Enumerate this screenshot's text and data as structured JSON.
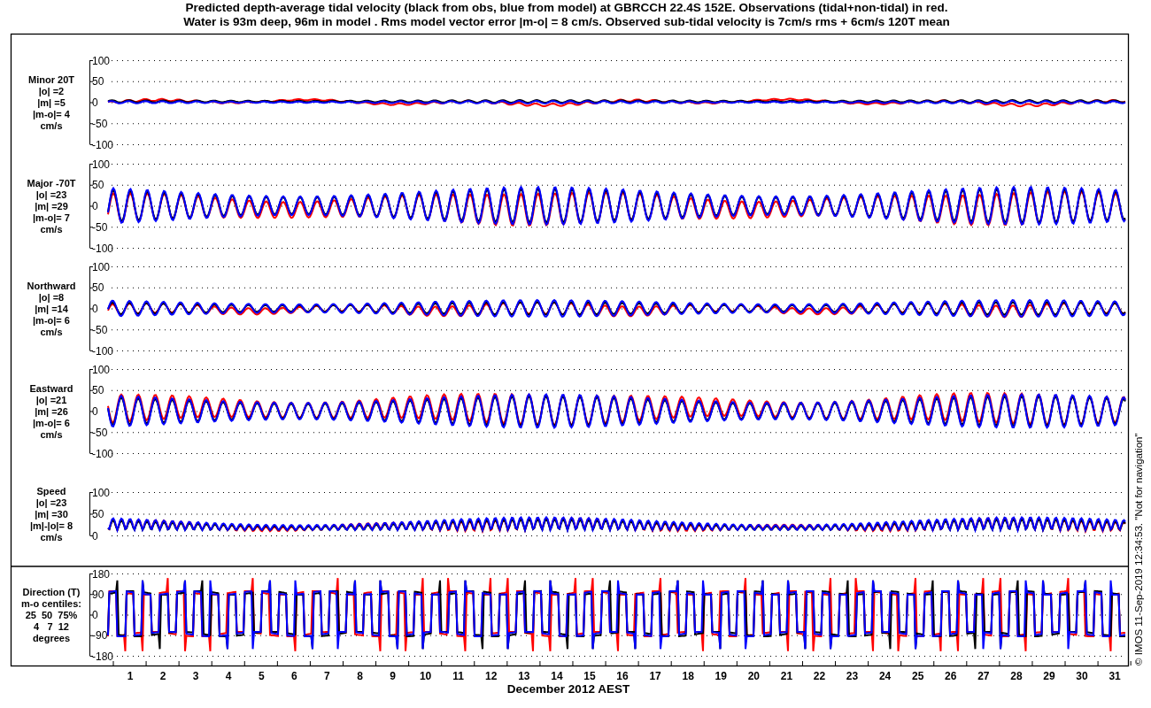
{
  "title_lines": [
    "Predicted depth-average tidal velocity (black from obs, blue from model) at GBRCCH 22.4S 152E. Observations (tidal+non-tidal) in red.",
    "Water is 93m deep, 96m in model . Rms model vector error |m-o| = 8 cm/s. Observed sub-tidal velocity is 7cm/s rms + 6cm/s 120T mean"
  ],
  "panels": [
    {
      "kind": "minor",
      "label_lines": [
        "Minor 20T",
        "|o| =2",
        "|m| =5",
        "|m-o|= 4",
        "cm/s"
      ],
      "yticks": [
        "100",
        "50",
        "0",
        "-50",
        "-100"
      ]
    },
    {
      "kind": "major",
      "label_lines": [
        "Major -70T",
        "|o| =23",
        "|m| =29",
        "|m-o|= 7",
        "cm/s"
      ],
      "yticks": [
        "100",
        "50",
        "0",
        "-50",
        "-100"
      ]
    },
    {
      "kind": "northward",
      "label_lines": [
        "Northward",
        "|o| =8",
        "|m| =14",
        "|m-o|= 6",
        "cm/s"
      ],
      "yticks": [
        "100",
        "50",
        "0",
        "-50",
        "-100"
      ]
    },
    {
      "kind": "eastward",
      "label_lines": [
        "Eastward",
        "|o| =21",
        "|m| =26",
        "|m-o|= 6",
        "cm/s"
      ],
      "yticks": [
        "100",
        "50",
        "0",
        "-50",
        "-100"
      ]
    },
    {
      "kind": "speed",
      "label_lines": [
        "Speed",
        "|o| =23",
        "|m| =30",
        "|m|-|o|= 8",
        "cm/s"
      ],
      "yticks": [
        "100",
        "50",
        "0"
      ]
    },
    {
      "kind": "direction",
      "label_lines": [
        "Direction (T)",
        "m-o centiles:",
        "25  50  75%",
        "4   7  12",
        "degrees"
      ],
      "yticks": [
        "180",
        "90",
        "0",
        "-90",
        "-180"
      ]
    }
  ],
  "x_axis": {
    "ticks": [
      "1",
      "2",
      "3",
      "4",
      "5",
      "6",
      "7",
      "8",
      "9",
      "10",
      "11",
      "12",
      "13",
      "14",
      "15",
      "16",
      "17",
      "18",
      "19",
      "20",
      "21",
      "22",
      "23",
      "24",
      "25",
      "26",
      "27",
      "28",
      "29",
      "30",
      "31"
    ],
    "label": "December 2012 AEST"
  },
  "credit": "© IMOS 11-Sep-2019 12:34:53. \"Not for navigation\""
}
